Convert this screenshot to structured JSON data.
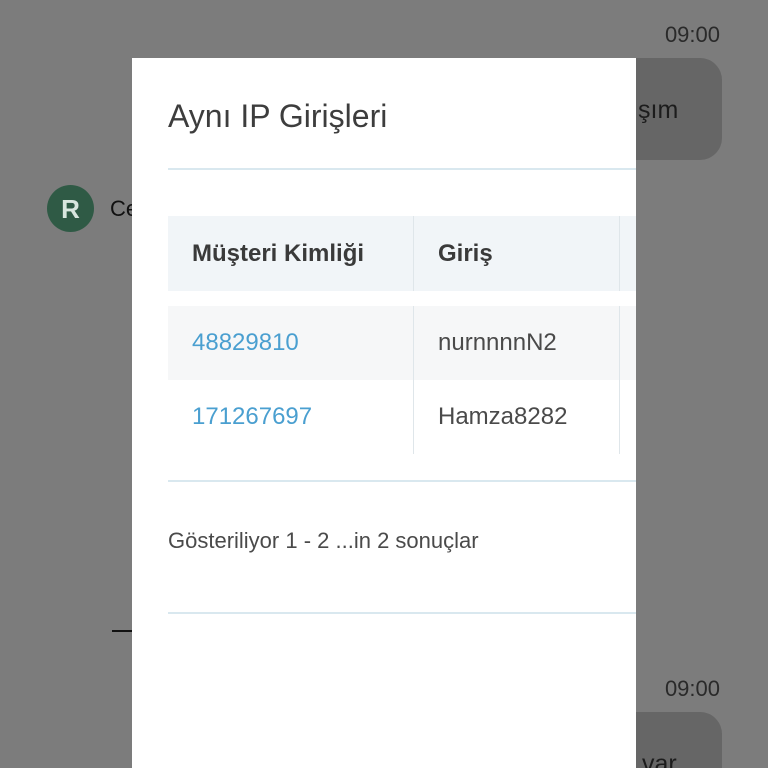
{
  "chat": {
    "time_top": "09:00",
    "time_bottom": "09:00",
    "bubble_top_text": "şım",
    "bubble_bottom_text": "var",
    "avatar_letter": "R",
    "sender_name_partial": "Ce"
  },
  "modal": {
    "title": "Aynı IP Girişleri",
    "columns": [
      "Müşteri Kimliği",
      "Giriş"
    ],
    "rows": [
      {
        "customer_id": "48829810",
        "login": "nurnnnnN2"
      },
      {
        "customer_id": "171267697",
        "login": "Hamza8282"
      }
    ],
    "footer": "Gösteriliyor 1 - 2 ...in 2 sonuçlar"
  },
  "colors": {
    "overlay": "#7c7c7c",
    "link": "#4a9fd0",
    "header_bg": "#f1f5f8",
    "divider": "#d9e8ef"
  }
}
